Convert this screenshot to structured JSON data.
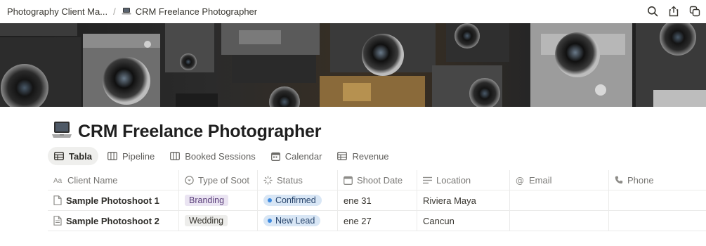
{
  "breadcrumb": {
    "parent": "Photography Client Ma...",
    "separator": "/",
    "current": "CRM Freelance Photographer",
    "current_icon": "laptop-icon"
  },
  "topbar_actions": [
    "search-icon",
    "share-icon",
    "duplicate-icon"
  ],
  "page": {
    "title": "CRM Freelance Photographer",
    "icon": "laptop-icon"
  },
  "tabs": [
    {
      "label": "Tabla",
      "icon": "table-icon",
      "active": true
    },
    {
      "label": "Pipeline",
      "icon": "board-icon",
      "active": false
    },
    {
      "label": "Booked Sessions",
      "icon": "board-icon",
      "active": false
    },
    {
      "label": "Calendar",
      "icon": "calendar-icon",
      "active": false
    },
    {
      "label": "Revenue",
      "icon": "table-icon",
      "active": false
    }
  ],
  "table": {
    "columns": [
      {
        "label": "Client Name",
        "icon": "title-icon"
      },
      {
        "label": "Type of Soot",
        "icon": "select-icon"
      },
      {
        "label": "Status",
        "icon": "status-icon"
      },
      {
        "label": "Shoot Date",
        "icon": "calendar-icon"
      },
      {
        "label": "Location",
        "icon": "text-icon"
      },
      {
        "label": "Email",
        "icon": "at-icon"
      },
      {
        "label": "Phone",
        "icon": "phone-icon"
      }
    ],
    "rows": [
      {
        "name": "Sample Photoshoot 1",
        "type": "Branding",
        "status": "Confirmed",
        "date": "ene 31",
        "location": "Riviera Maya",
        "email": "",
        "phone": ""
      },
      {
        "name": "Sample Photoshoot 2",
        "type": "Wedding",
        "status": "New Lead",
        "date": "ene 27",
        "location": "Cancun",
        "email": "",
        "phone": ""
      }
    ]
  },
  "colors": {
    "branding_tag_bg": "#eae4f2",
    "branding_tag_text": "#5a3e7a",
    "wedding_tag_bg": "#ededeb",
    "wedding_tag_text": "#37352f",
    "status_bg": "#d8e6f5",
    "status_text": "#28456c",
    "status_dot": "#3e8be0"
  }
}
